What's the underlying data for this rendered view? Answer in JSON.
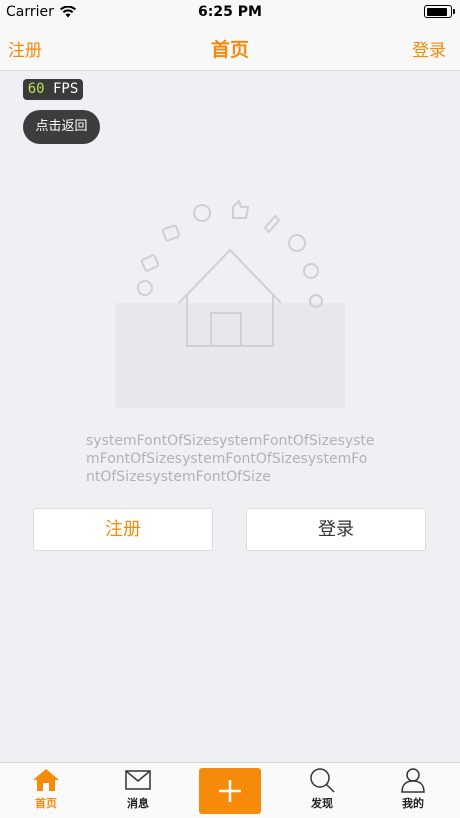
{
  "status_bar": {
    "carrier": "Carrier",
    "time": "6:25 PM",
    "battery_level": 0.92
  },
  "nav": {
    "left_label": "注册",
    "title": "首页",
    "right_label": "登录"
  },
  "fps": {
    "value": "60",
    "unit": "FPS"
  },
  "back_button": {
    "label": "点击返回"
  },
  "content": {
    "long_text": "systemFontOfSizesystemFontOfSizesystemFontOfSizesystemFontOfSizesystemFontOfSizesystemFontOfSize",
    "register_label": "注册",
    "login_label": "登录"
  },
  "tabs": [
    {
      "label": "首页",
      "icon": "home-icon",
      "active": true
    },
    {
      "label": "消息",
      "icon": "mail-icon",
      "active": false
    },
    {
      "label": "发现",
      "icon": "search-icon",
      "active": false
    },
    {
      "label": "我的",
      "icon": "profile-icon",
      "active": false
    }
  ],
  "colors": {
    "accent": "#f58a0b",
    "background": "#efeff4",
    "fps_number": "#b6e055"
  }
}
